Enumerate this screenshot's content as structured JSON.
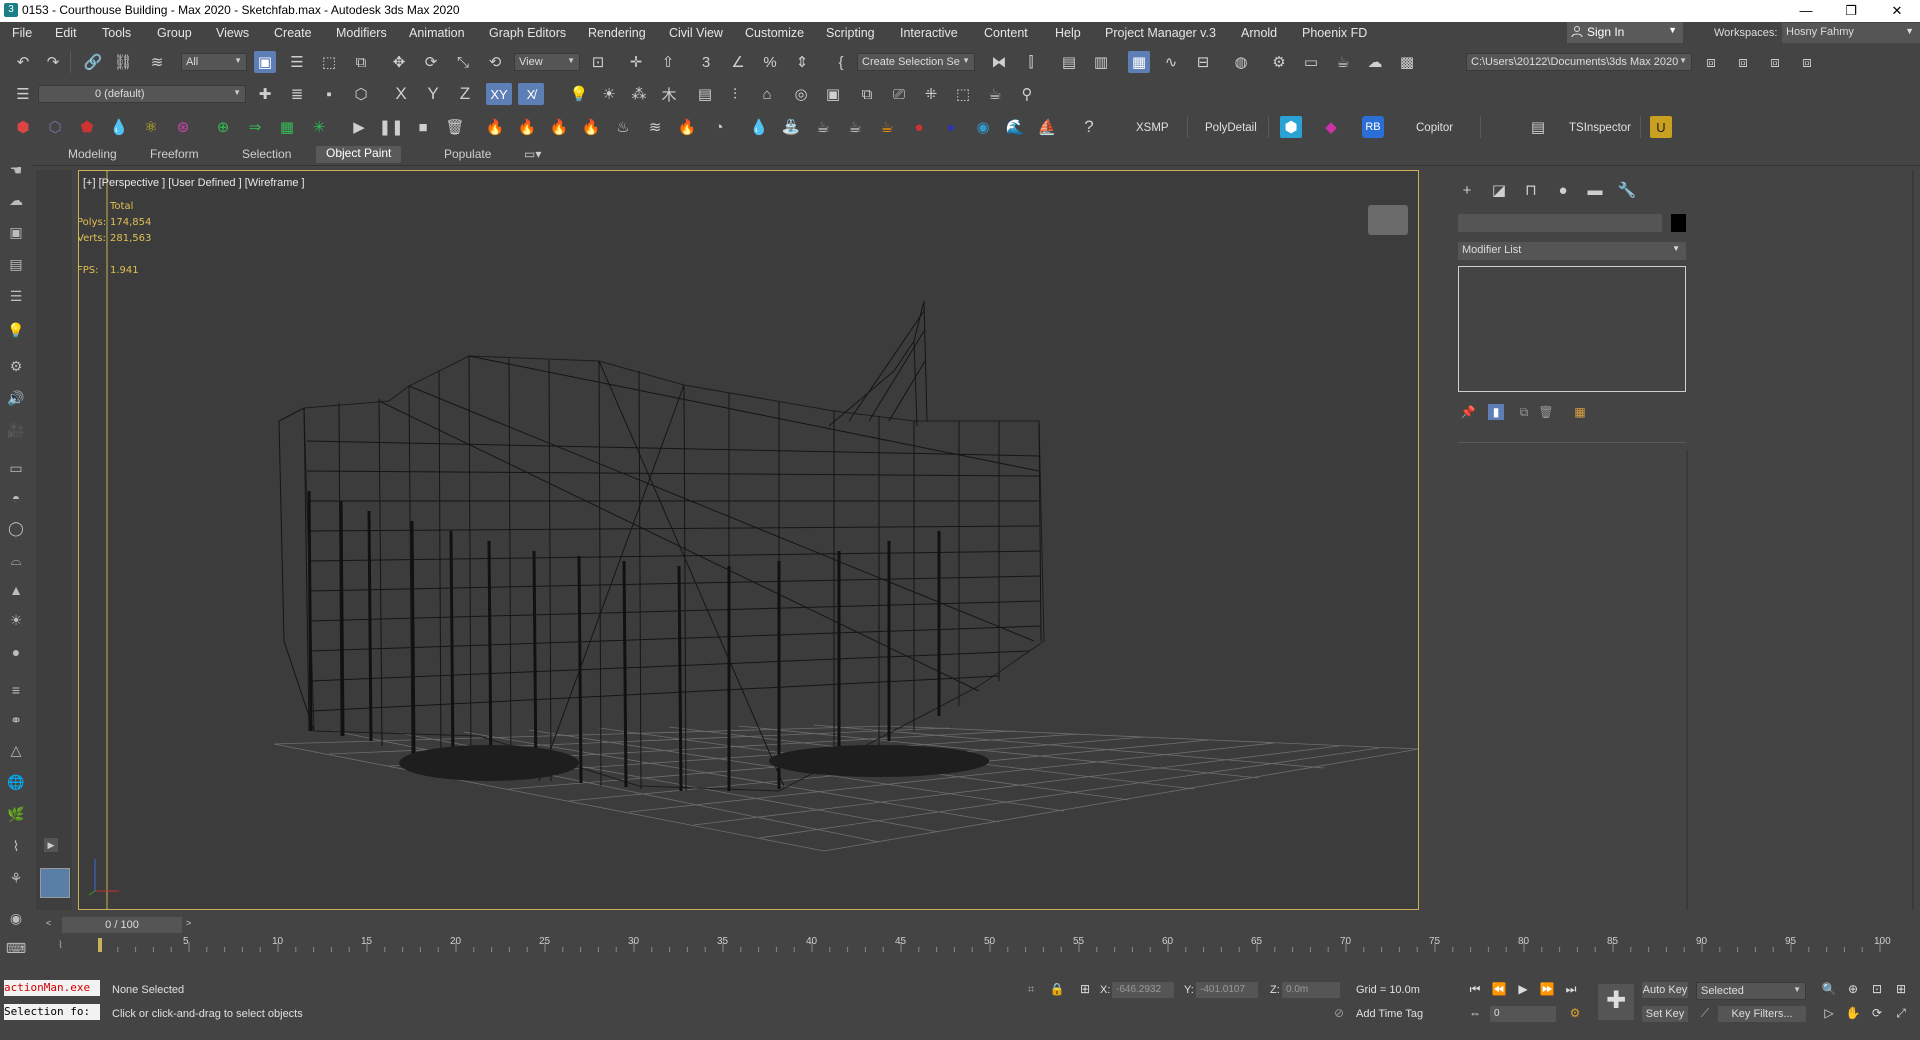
{
  "window": {
    "title": "0153 - Courthouse Building - Max 2020 - Sketchfab.max - Autodesk 3ds Max 2020",
    "minimize": "—",
    "maximize": "❐",
    "close": "✕"
  },
  "menu": [
    "File",
    "Edit",
    "Tools",
    "Group",
    "Views",
    "Create",
    "Modifiers",
    "Animation",
    "Graph Editors",
    "Rendering",
    "Civil View",
    "Customize",
    "Scripting",
    "Interactive",
    "Content",
    "Help",
    "Project Manager v.3",
    "Arnold",
    "Phoenix FD"
  ],
  "account": {
    "sign_in": "Sign In",
    "workspaces_label": "Workspaces:",
    "workspace_value": "Hosny Fahmy"
  },
  "toolbar1": {
    "filter_select": "All",
    "view_select": "View",
    "selection_set": "Create Selection Se",
    "project_path": "C:\\Users\\20122\\Documents\\3ds Max 2020"
  },
  "toolbar2": {
    "layer_select": "0 (default)",
    "axis_x": "X",
    "axis_y": "Y",
    "axis_z": "Z",
    "axis_xy": "XY",
    "axis_xz": "X̸"
  },
  "toolbar3": {
    "xsmp": "XSMP",
    "polydetail": "PolyDetail",
    "rb": "RB",
    "copitor": "Copitor",
    "tsinspector": "TSInspector"
  },
  "ribbon": {
    "tabs": [
      "Modeling",
      "Freeform",
      "Selection",
      "Object Paint",
      "Populate"
    ],
    "active": "Object Paint"
  },
  "viewport": {
    "label": "[+] [Perspective ] [User Defined ] [Wireframe ]",
    "stats": {
      "total_label": "Total",
      "polys_label": "Polys:",
      "polys_value": "174,854",
      "verts_label": "Verts:",
      "verts_value": "281,563",
      "fps_label": "FPS:",
      "fps_value": "1.941"
    }
  },
  "command_panel": {
    "modifier_list": "Modifier List"
  },
  "timeline": {
    "slider": "0 / 100",
    "ticks": [
      "0",
      "5",
      "10",
      "15",
      "20",
      "25",
      "30",
      "35",
      "40",
      "45",
      "50",
      "55",
      "60",
      "65",
      "70",
      "75",
      "80",
      "85",
      "90",
      "95",
      "100"
    ]
  },
  "status": {
    "maxscript_1": "actionMan.exe",
    "maxscript_2": "Selection fo:",
    "selection": "None Selected",
    "prompt": "Click or click-and-drag to select objects",
    "x_label": "X:",
    "x_value": "-646.2932",
    "y_label": "Y:",
    "y_value": "-401.0107",
    "z_label": "Z:",
    "z_value": "0.0m",
    "grid": "Grid = 10.0m",
    "add_time_tag": "Add Time Tag",
    "auto_key": "Auto Key",
    "set_key": "Set Key",
    "key_mode": "Selected",
    "key_filters": "Key Filters...",
    "frame": "0"
  },
  "colors": {
    "ui_bg": "#444444",
    "viewport_bg": "#3c3c3c",
    "viewport_border": "#c8b25a",
    "stats_text": "#e0c050",
    "active_button": "#5d7fb5"
  }
}
